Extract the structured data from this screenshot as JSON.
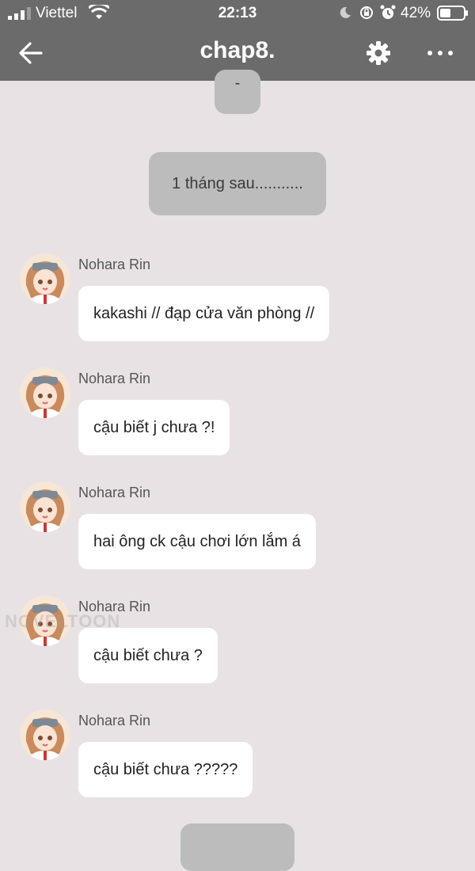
{
  "status_bar": {
    "carrier": "Viettel",
    "time": "22:13",
    "battery": "42%"
  },
  "header": {
    "title": "chap8.",
    "back_icon": "back-arrow-icon",
    "settings_icon": "gear-icon",
    "more_icon": "more-icon"
  },
  "system_messages": [
    {
      "text": "-"
    },
    {
      "text": "1 tháng sau..........."
    },
    {
      "text": ""
    }
  ],
  "messages": [
    {
      "sender": "Nohara Rin",
      "text": "kakashi // đạp cửa văn phòng //"
    },
    {
      "sender": "Nohara Rin",
      "text": "cậu biết j chưa ?!"
    },
    {
      "sender": "Nohara Rin",
      "text": "hai ông ck cậu chơi lớn lắm á"
    },
    {
      "sender": "Nohara Rin",
      "text": "cậu biết chưa ?"
    },
    {
      "sender": "Nohara Rin",
      "text": "cậu biết chưa ?????"
    }
  ],
  "watermark": "NOVELTOON",
  "colors": {
    "header_bg": "#6b6b6b",
    "page_bg": "#e9e2e5",
    "system_bubble": "#bcbcbc",
    "message_bubble": "#ffffff"
  }
}
